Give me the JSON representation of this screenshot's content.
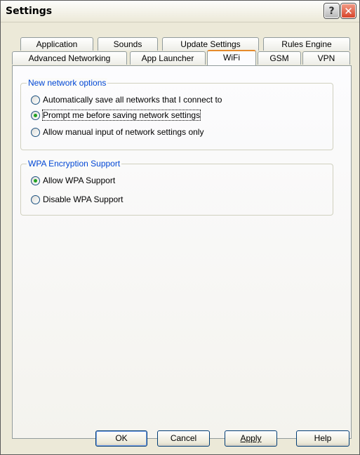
{
  "window": {
    "title": "Settings",
    "help_glyph": "?",
    "close_glyph": "✕"
  },
  "tabs": {
    "row1": [
      "Application",
      "Sounds",
      "Update Settings",
      "Rules Engine"
    ],
    "row2": [
      "Advanced Networking",
      "App Launcher",
      "WiFi",
      "GSM",
      "VPN"
    ],
    "active": "WiFi"
  },
  "groups": {
    "new_network": {
      "legend": "New network options",
      "options": [
        {
          "label": "Automatically save all networks that I connect to",
          "checked": false
        },
        {
          "label": "Prompt me before saving network settings",
          "checked": true
        },
        {
          "label": "Allow manual input of network settings only",
          "checked": false
        }
      ]
    },
    "wpa": {
      "legend": "WPA Encryption Support",
      "options": [
        {
          "label": "Allow WPA Support",
          "checked": true
        },
        {
          "label": "Disable WPA Support",
          "checked": false
        }
      ]
    }
  },
  "buttons": {
    "ok": "OK",
    "cancel": "Cancel",
    "apply": "Apply",
    "help": "Help"
  },
  "colors": {
    "accent_tab": "#e68b2c",
    "legend_text": "#0046d5",
    "close_red": "#d8452a"
  }
}
